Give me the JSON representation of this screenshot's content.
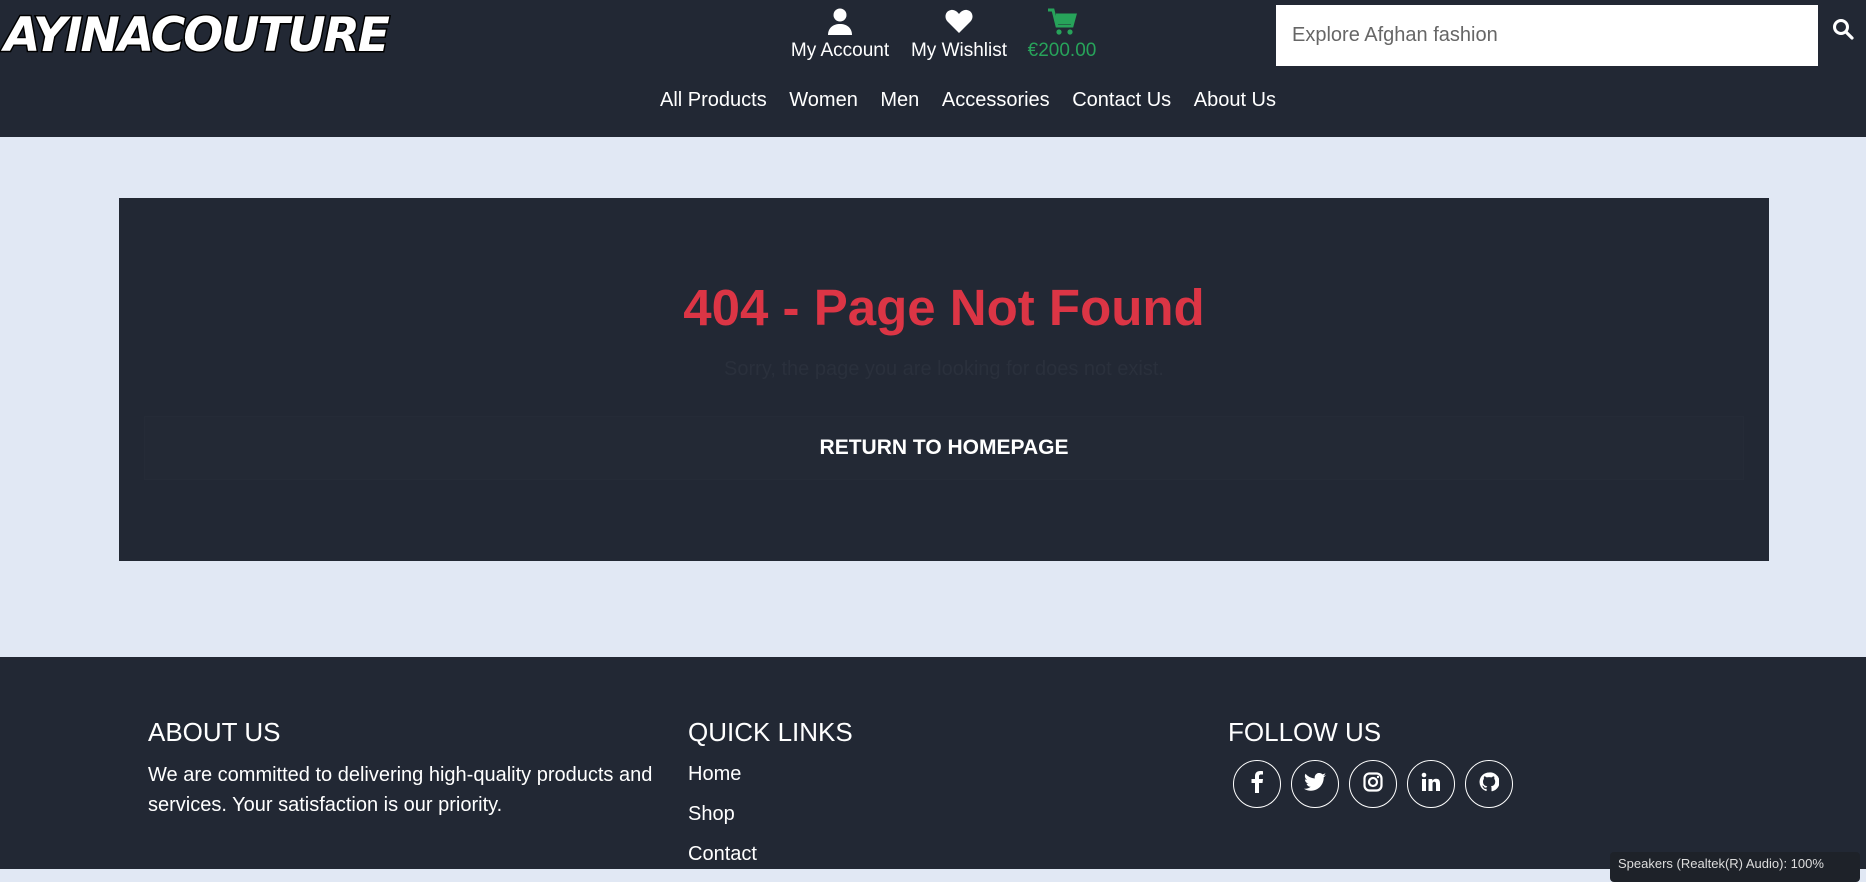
{
  "brand": {
    "logo_text": "AYINACOUTURE"
  },
  "header": {
    "account_label": "My Account",
    "wishlist_label": "My Wishlist",
    "cart_total": "€200.00",
    "search_placeholder": "Explore Afghan fashion",
    "cart_color": "#27a35a"
  },
  "nav": {
    "items": [
      "All Products",
      "Women",
      "Men",
      "Accessories",
      "Contact Us",
      "About Us"
    ]
  },
  "error": {
    "title": "404 - Page Not Found",
    "subtitle": "Sorry, the page you are looking for does not exist.",
    "button_label": "RETURN TO HOMEPAGE",
    "title_color": "#dc3545"
  },
  "footer": {
    "about_title": "ABOUT US",
    "about_text": "We are committed to delivering high-quality products and services. Your satisfaction is our priority.",
    "quick_title": "QUICK LINKS",
    "quick_links": [
      "Home",
      "Shop",
      "Contact"
    ],
    "follow_title": "FOLLOW US",
    "socials": [
      "facebook-icon",
      "twitter-icon",
      "instagram-icon",
      "linkedin-icon",
      "github-icon"
    ]
  },
  "system": {
    "status_text": "Speakers (Realtek(R) Audio): 100%"
  },
  "colors": {
    "header_bg": "#222834",
    "page_bg": "#e1e8f4"
  }
}
